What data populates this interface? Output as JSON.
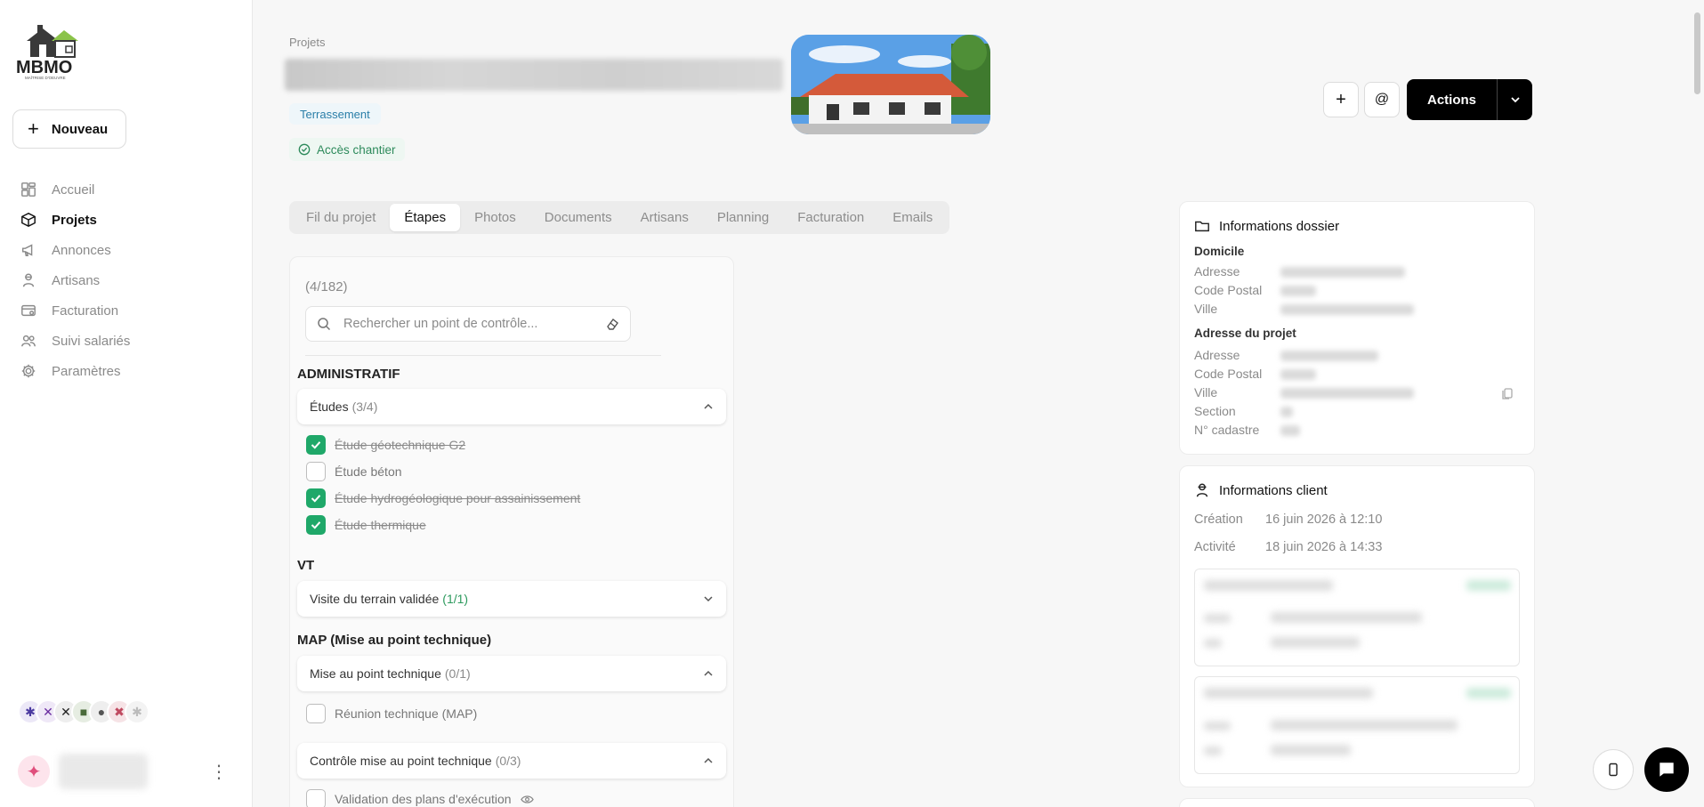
{
  "sidebar": {
    "logo_text": "MBMO",
    "logo_sub": "MAÎTRISE D'OEUVRE",
    "new_button": "Nouveau",
    "nav": [
      {
        "label": "Accueil",
        "icon": "dashboard-icon",
        "active": false
      },
      {
        "label": "Projets",
        "icon": "box-icon",
        "active": true
      },
      {
        "label": "Annonces",
        "icon": "megaphone-icon",
        "active": false
      },
      {
        "label": "Artisans",
        "icon": "worker-icon",
        "active": false
      },
      {
        "label": "Facturation",
        "icon": "invoice-icon",
        "active": false
      },
      {
        "label": "Suivi salariés",
        "icon": "team-icon",
        "active": false
      },
      {
        "label": "Paramètres",
        "icon": "gear-icon",
        "active": false
      }
    ]
  },
  "header": {
    "breadcrumb": "Projets",
    "tag_phase": "Terrassement",
    "tag_access": "Accès chantier",
    "actions_label": "Actions"
  },
  "tabs": [
    "Fil du projet",
    "Étapes",
    "Photos",
    "Documents",
    "Artisans",
    "Planning",
    "Facturation",
    "Emails"
  ],
  "active_tab": "Étapes",
  "steps": {
    "count": "(4/182)",
    "search_placeholder": "Rechercher un point de contrôle...",
    "sections": {
      "administratif": "ADMINISTRATIF",
      "vt": "VT",
      "map": "MAP (Mise au point technique)"
    },
    "groups": {
      "etudes": {
        "label": "Études",
        "count": "(3/4)"
      },
      "visite": {
        "label": "Visite du terrain validée",
        "count": "(1/1)"
      },
      "mise_point": {
        "label": "Mise au point technique",
        "count": "(0/1)"
      },
      "controle": {
        "label": "Contrôle mise au point technique",
        "count": "(0/3)"
      }
    },
    "items": {
      "etude_geo": "Étude géotechnique G2",
      "etude_beton": "Étude béton",
      "etude_hydro": "Étude hydrogéologique pour assainissement",
      "etude_thermique": "Étude thermique",
      "reunion_map": "Réunion technique (MAP)",
      "validation_plans": "Validation des plans d'exécution"
    }
  },
  "dossier": {
    "title": "Informations dossier",
    "domicile": "Domicile",
    "adresse": "Adresse",
    "code_postal": "Code Postal",
    "ville": "Ville",
    "adresse_projet": "Adresse du projet",
    "section": "Section",
    "cadastre": "N° cadastre"
  },
  "client": {
    "title": "Informations client",
    "creation_label": "Création",
    "creation_value": "16 juin 2026 à 12:10",
    "activite_label": "Activité",
    "activite_value": "18 juin 2026 à 14:33"
  },
  "colors": {
    "accent_green": "#1fa869",
    "tag_blue": "#2a7ea8",
    "primary_black": "#000000"
  }
}
